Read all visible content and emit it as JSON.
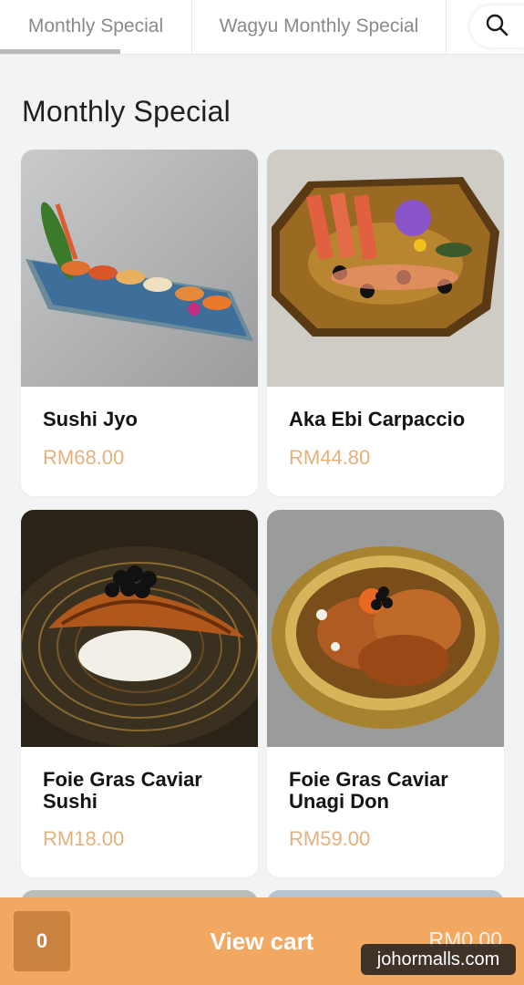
{
  "tabs": [
    {
      "label": "Monthly Special"
    },
    {
      "label": "Wagyu Monthly Special"
    }
  ],
  "search": {
    "icon": "search-icon"
  },
  "section": {
    "title": "Monthly Special"
  },
  "items": [
    {
      "name": "Sushi Jyo",
      "price": "RM68.00"
    },
    {
      "name": "Aka Ebi Carpaccio",
      "price": "RM44.80"
    },
    {
      "name": "Foie Gras Caviar Sushi",
      "price": "RM18.00"
    },
    {
      "name": "Foie Gras Caviar Unagi Don",
      "price": "RM59.00"
    }
  ],
  "cart": {
    "count": "0",
    "label": "View cart",
    "total": "RM0.00"
  },
  "watermark": "johormalls.com",
  "colors": {
    "accent": "#f3a862",
    "price": "#e6b07a",
    "count_bg": "#c9833e"
  }
}
